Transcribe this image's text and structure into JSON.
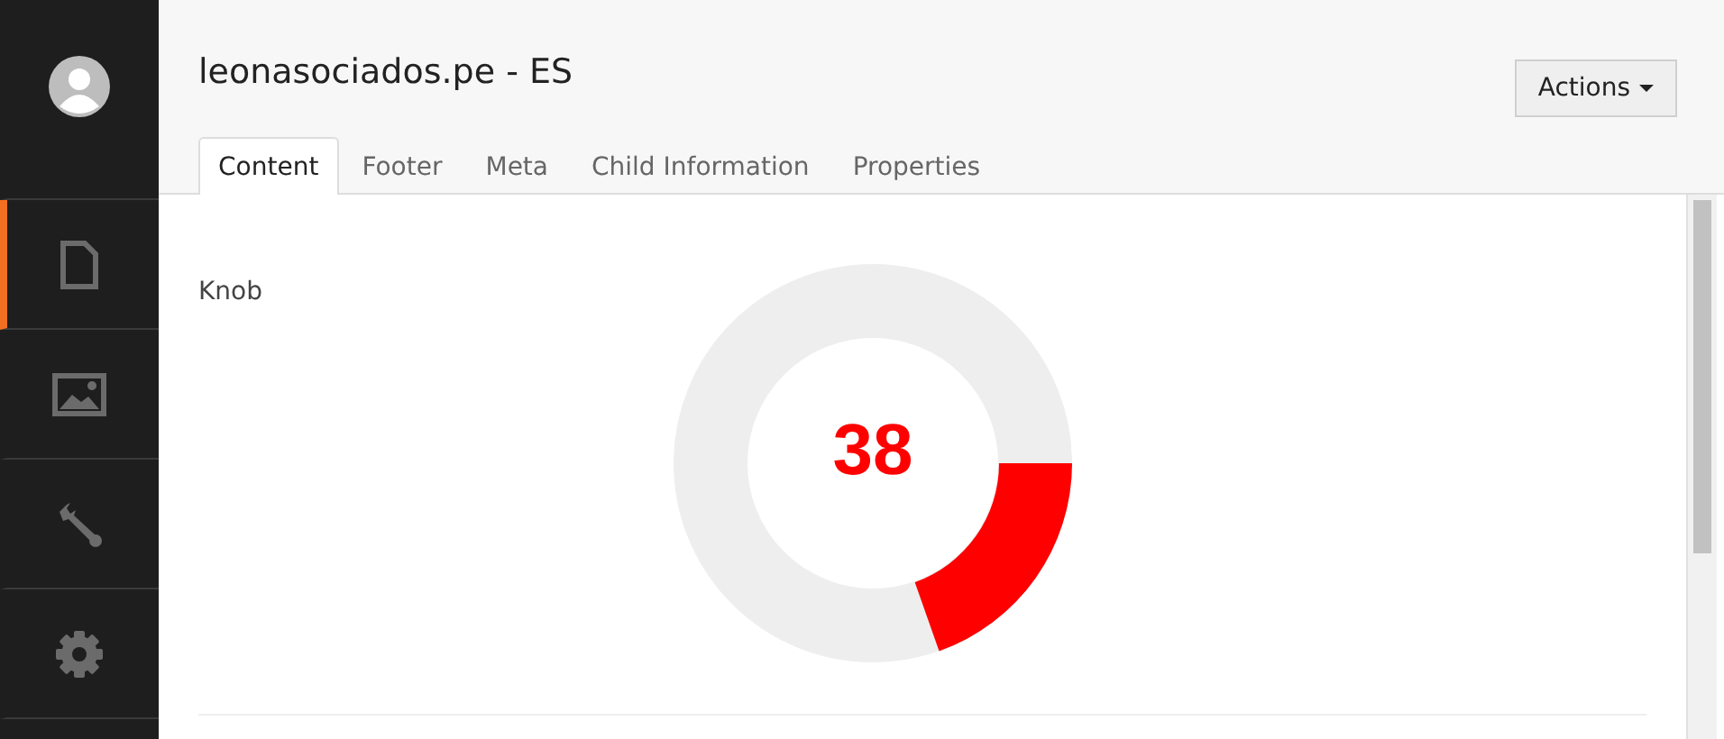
{
  "sidebar": {
    "items": [
      {
        "kind": "avatar",
        "selected": false
      },
      {
        "kind": "document",
        "selected": true
      },
      {
        "kind": "image",
        "selected": false
      },
      {
        "kind": "wrench",
        "selected": false
      },
      {
        "kind": "gear",
        "selected": false
      }
    ]
  },
  "header": {
    "title": "leonasociados.pe - ES",
    "actions_button": "Actions"
  },
  "tabs": [
    {
      "label": "Content",
      "selected": true
    },
    {
      "label": "Footer",
      "selected": false
    },
    {
      "label": "Meta",
      "selected": false
    },
    {
      "label": "Child Information",
      "selected": false
    },
    {
      "label": "Properties",
      "selected": false
    }
  ],
  "field": {
    "label": "Knob",
    "knob": {
      "value": "38"
    }
  }
}
